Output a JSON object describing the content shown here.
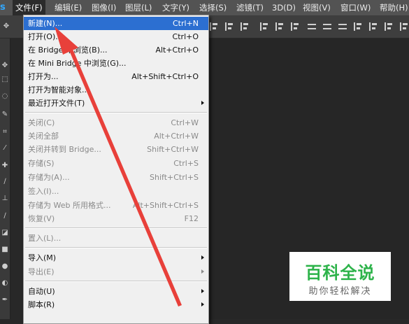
{
  "app": {
    "logo_letter": "s"
  },
  "menubar": {
    "items": [
      {
        "label": "文件(F)"
      },
      {
        "label": "编辑(E)"
      },
      {
        "label": "图像(I)"
      },
      {
        "label": "图层(L)"
      },
      {
        "label": "文字(Y)"
      },
      {
        "label": "选择(S)"
      },
      {
        "label": "滤镜(T)"
      },
      {
        "label": "3D(D)"
      },
      {
        "label": "视图(V)"
      },
      {
        "label": "窗口(W)"
      },
      {
        "label": "帮助(H)"
      }
    ]
  },
  "file_menu": {
    "items": [
      {
        "label": "新建(N)...",
        "shortcut": "Ctrl+N",
        "highlighted": true
      },
      {
        "label": "打开(O)...",
        "shortcut": "Ctrl+O"
      },
      {
        "label": "在 Bridge 中浏览(B)...",
        "shortcut": "Alt+Ctrl+O"
      },
      {
        "label": "在 Mini Bridge 中浏览(G)..."
      },
      {
        "label": "打开为...",
        "shortcut": "Alt+Shift+Ctrl+O"
      },
      {
        "label": "打开为智能对象..."
      },
      {
        "label": "最近打开文件(T)",
        "submenu": true
      },
      {
        "label": "关闭(C)",
        "shortcut": "Ctrl+W",
        "disabled": true
      },
      {
        "label": "关闭全部",
        "shortcut": "Alt+Ctrl+W",
        "disabled": true
      },
      {
        "label": "关闭并转到 Bridge...",
        "shortcut": "Shift+Ctrl+W",
        "disabled": true
      },
      {
        "label": "存储(S)",
        "shortcut": "Ctrl+S",
        "disabled": true
      },
      {
        "label": "存储为(A)...",
        "shortcut": "Shift+Ctrl+S",
        "disabled": true
      },
      {
        "label": "签入(I)...",
        "disabled": true
      },
      {
        "label": "存储为 Web 所用格式...",
        "shortcut": "Alt+Shift+Ctrl+S",
        "disabled": true
      },
      {
        "label": "恢复(V)",
        "shortcut": "F12",
        "disabled": true
      },
      {
        "label": "置入(L)...",
        "disabled": true
      },
      {
        "label": "导入(M)",
        "submenu": true
      },
      {
        "label": "导出(E)",
        "submenu": true,
        "disabled": true
      },
      {
        "label": "自动(U)",
        "submenu": true
      },
      {
        "label": "脚本(R)",
        "submenu": true
      }
    ]
  },
  "watermark": {
    "title": "百科全说",
    "subtitle": "助你轻松解决",
    "title_color": "#2db34a"
  },
  "colors": {
    "highlight": "#2c6fd1",
    "arrow": "#e8403a"
  }
}
